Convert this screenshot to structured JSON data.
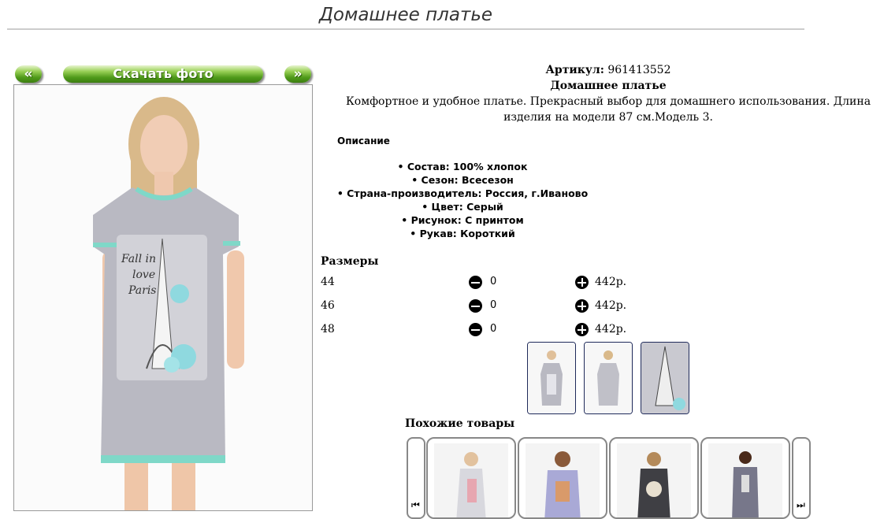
{
  "page": {
    "title": "Домашнее платье"
  },
  "nav": {
    "prev_label": "«",
    "download_label": "Скачать фото",
    "next_label": "»"
  },
  "product": {
    "article_label": "Артикул:",
    "article_value": "961413552",
    "name": "Домашнее платье",
    "description": "Комфортное и удобное платье. Прекрасный выбор для домашнего использования. Длина изделия на модели 87 см.Модель 3."
  },
  "description_section": {
    "heading": "Описание",
    "properties": [
      "Состав: 100% хлопок",
      "Сезон: Всесезон",
      "Страна-производитель: Россия, г.Иваново",
      "Цвет: Серый",
      "Рисунок: С принтом",
      "Рукав: Короткий"
    ]
  },
  "sizes": {
    "heading": "Размеры",
    "rows": [
      {
        "size": "44",
        "qty": "0",
        "price": "442р."
      },
      {
        "size": "46",
        "qty": "0",
        "price": "442р."
      },
      {
        "size": "48",
        "qty": "0",
        "price": "442р."
      }
    ]
  },
  "similar": {
    "heading": "Похожие товары",
    "prev_icon": "skip-back-icon",
    "next_icon": "skip-forward-icon"
  },
  "colors": {
    "button_green": "#4f9a1a",
    "dress_gray": "#b9b9c2",
    "trim_mint": "#7fd8c8"
  }
}
